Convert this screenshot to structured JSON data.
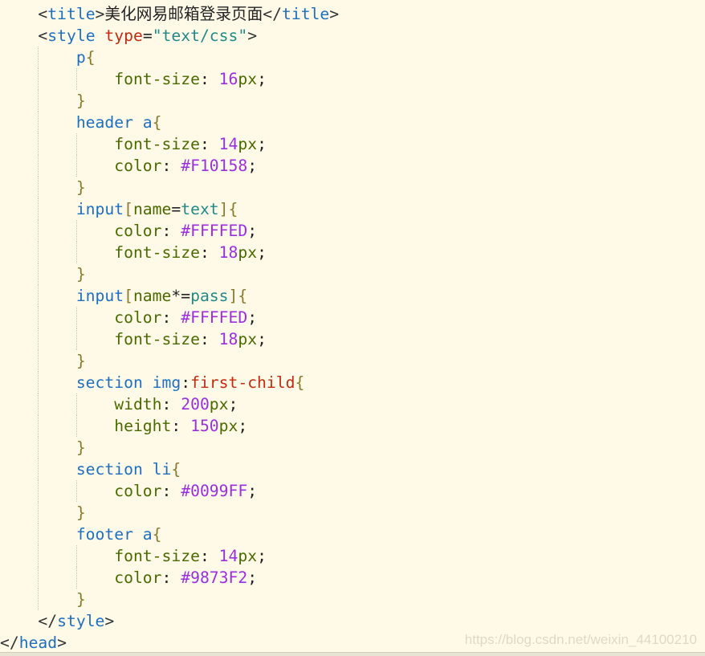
{
  "editor": {
    "lines": [
      {
        "indent": 1,
        "tokens": [
          [
            "<",
            "br"
          ],
          [
            "title",
            "tag"
          ],
          [
            ">",
            "br"
          ],
          [
            "美化网易邮箱登录页面",
            "txt"
          ],
          [
            "</",
            "br"
          ],
          [
            "title",
            "tag"
          ],
          [
            ">",
            "br"
          ]
        ]
      },
      {
        "indent": 1,
        "tokens": [
          [
            "<",
            "br"
          ],
          [
            "style",
            "tag"
          ],
          [
            " ",
            "txt"
          ],
          [
            "type",
            "attr"
          ],
          [
            "=",
            "pun"
          ],
          [
            "\"text/css\"",
            "str"
          ],
          [
            ">",
            "br"
          ]
        ]
      },
      {
        "indent": 2,
        "tokens": [
          [
            "p",
            "sel"
          ],
          [
            "{",
            "brace"
          ]
        ]
      },
      {
        "indent": 3,
        "tokens": [
          [
            "font-size",
            "prop"
          ],
          [
            ": ",
            "pun"
          ],
          [
            "16",
            "num"
          ],
          [
            "px",
            "prop"
          ],
          [
            ";",
            "pun"
          ]
        ]
      },
      {
        "indent": 2,
        "tokens": [
          [
            "}",
            "brace"
          ]
        ]
      },
      {
        "indent": 2,
        "tokens": [
          [
            "header a",
            "sel"
          ],
          [
            "{",
            "brace"
          ]
        ]
      },
      {
        "indent": 3,
        "tokens": [
          [
            "font-size",
            "prop"
          ],
          [
            ": ",
            "pun"
          ],
          [
            "14",
            "num"
          ],
          [
            "px",
            "prop"
          ],
          [
            ";",
            "pun"
          ]
        ]
      },
      {
        "indent": 3,
        "tokens": [
          [
            "color",
            "prop"
          ],
          [
            ": ",
            "pun"
          ],
          [
            "#F10158",
            "num"
          ],
          [
            ";",
            "pun"
          ]
        ]
      },
      {
        "indent": 2,
        "tokens": [
          [
            "}",
            "brace"
          ]
        ]
      },
      {
        "indent": 2,
        "tokens": [
          [
            "input",
            "sel"
          ],
          [
            "[",
            "brace"
          ],
          [
            "name",
            "prop"
          ],
          [
            "=",
            "pun"
          ],
          [
            "text",
            "str"
          ],
          [
            "]",
            "brace"
          ],
          [
            "{",
            "brace"
          ]
        ]
      },
      {
        "indent": 3,
        "tokens": [
          [
            "color",
            "prop"
          ],
          [
            ": ",
            "pun"
          ],
          [
            "#FFFFED",
            "num"
          ],
          [
            ";",
            "pun"
          ]
        ]
      },
      {
        "indent": 3,
        "tokens": [
          [
            "font-size",
            "prop"
          ],
          [
            ": ",
            "pun"
          ],
          [
            "18",
            "num"
          ],
          [
            "px",
            "prop"
          ],
          [
            ";",
            "pun"
          ]
        ]
      },
      {
        "indent": 2,
        "tokens": [
          [
            "}",
            "brace"
          ]
        ]
      },
      {
        "indent": 2,
        "tokens": [
          [
            "input",
            "sel"
          ],
          [
            "[",
            "brace"
          ],
          [
            "name",
            "prop"
          ],
          [
            "*=",
            "pun"
          ],
          [
            "pass",
            "str"
          ],
          [
            "]",
            "brace"
          ],
          [
            "{",
            "brace"
          ]
        ]
      },
      {
        "indent": 3,
        "tokens": [
          [
            "color",
            "prop"
          ],
          [
            ": ",
            "pun"
          ],
          [
            "#FFFFED",
            "num"
          ],
          [
            ";",
            "pun"
          ]
        ]
      },
      {
        "indent": 3,
        "tokens": [
          [
            "font-size",
            "prop"
          ],
          [
            ": ",
            "pun"
          ],
          [
            "18",
            "num"
          ],
          [
            "px",
            "prop"
          ],
          [
            ";",
            "pun"
          ]
        ]
      },
      {
        "indent": 2,
        "tokens": [
          [
            "}",
            "brace"
          ]
        ]
      },
      {
        "indent": 2,
        "tokens": [
          [
            "section img",
            "sel"
          ],
          [
            ":",
            "pun"
          ],
          [
            "first-child",
            "pc"
          ],
          [
            "{",
            "brace"
          ]
        ]
      },
      {
        "indent": 3,
        "tokens": [
          [
            "width",
            "prop"
          ],
          [
            ": ",
            "pun"
          ],
          [
            "200",
            "num"
          ],
          [
            "px",
            "prop"
          ],
          [
            ";",
            "pun"
          ]
        ]
      },
      {
        "indent": 3,
        "tokens": [
          [
            "height",
            "prop"
          ],
          [
            ": ",
            "pun"
          ],
          [
            "150",
            "num"
          ],
          [
            "px",
            "prop"
          ],
          [
            ";",
            "pun"
          ]
        ]
      },
      {
        "indent": 2,
        "tokens": [
          [
            "}",
            "brace"
          ]
        ]
      },
      {
        "indent": 2,
        "tokens": [
          [
            "section li",
            "sel"
          ],
          [
            "{",
            "brace"
          ]
        ]
      },
      {
        "indent": 3,
        "tokens": [
          [
            "color",
            "prop"
          ],
          [
            ": ",
            "pun"
          ],
          [
            "#0099FF",
            "num"
          ],
          [
            ";",
            "pun"
          ]
        ]
      },
      {
        "indent": 2,
        "tokens": [
          [
            "}",
            "brace"
          ]
        ]
      },
      {
        "indent": 2,
        "tokens": [
          [
            "footer a",
            "sel"
          ],
          [
            "{",
            "brace"
          ]
        ]
      },
      {
        "indent": 3,
        "tokens": [
          [
            "font-size",
            "prop"
          ],
          [
            ": ",
            "pun"
          ],
          [
            "14",
            "num"
          ],
          [
            "px",
            "prop"
          ],
          [
            ";",
            "pun"
          ]
        ]
      },
      {
        "indent": 3,
        "tokens": [
          [
            "color",
            "prop"
          ],
          [
            ": ",
            "pun"
          ],
          [
            "#9873F2",
            "num"
          ],
          [
            ";",
            "pun"
          ]
        ]
      },
      {
        "indent": 2,
        "tokens": [
          [
            "}",
            "brace"
          ]
        ]
      },
      {
        "indent": 1,
        "tokens": [
          [
            "</",
            "br"
          ],
          [
            "style",
            "tag"
          ],
          [
            ">",
            "br"
          ]
        ]
      },
      {
        "indent": 0,
        "tokens": [
          [
            "</",
            "br"
          ],
          [
            "head",
            "tag"
          ],
          [
            ">",
            "br"
          ]
        ]
      }
    ]
  },
  "watermark": "https://blog.csdn.net/weixin_44100210",
  "colors": {
    "background": "#fffae8",
    "tag": "#1f6fc0",
    "attribute": "#c52a10",
    "string": "#208a86",
    "property": "#4a6a00",
    "number": "#9b2fe0",
    "brace": "#8a7a2e"
  }
}
